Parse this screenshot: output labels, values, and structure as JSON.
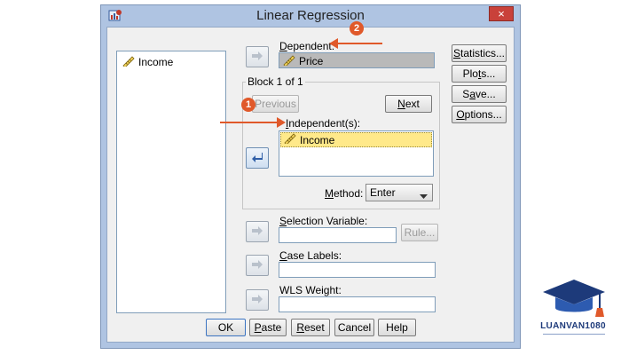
{
  "window": {
    "title": "Linear Regression",
    "close_glyph": "×"
  },
  "source_list": {
    "items": [
      {
        "label": "Income",
        "icon": "ruler-pencil-icon"
      }
    ]
  },
  "dependent": {
    "label_prefix": "D",
    "label_rest": "ependent:",
    "value": "Price"
  },
  "block": {
    "title": "Block 1 of 1",
    "previous_label": "Previous",
    "next_prefix": "N",
    "next_rest": "ext"
  },
  "independent": {
    "label_prefix": "I",
    "label_rest": "ndependent(s):",
    "items": [
      {
        "label": "Income"
      }
    ]
  },
  "method": {
    "label_prefix": "M",
    "label_rest": "ethod:",
    "value": "Enter"
  },
  "selection_variable": {
    "label_prefix": "S",
    "label_rest": "election Variable:",
    "value": "",
    "rule_label": "Rule..."
  },
  "case_labels": {
    "label_prefix": "C",
    "label_rest": "ase Labels:",
    "value": ""
  },
  "wls_weight": {
    "label": "WLS Weight:",
    "value": ""
  },
  "side_buttons": {
    "statistics": {
      "prefix": "S",
      "rest": "tatistics..."
    },
    "plots": {
      "before": "Plo",
      "u": "t",
      "after": "s..."
    },
    "save": {
      "before": "S",
      "u": "a",
      "after": "ve..."
    },
    "options": {
      "prefix": "O",
      "rest": "ptions..."
    }
  },
  "bottom_buttons": {
    "ok": "OK",
    "paste": {
      "prefix": "P",
      "rest": "aste"
    },
    "reset": {
      "prefix": "R",
      "rest": "eset"
    },
    "cancel": "Cancel",
    "help": "Help"
  },
  "annotations": {
    "badge_1": "1",
    "badge_2": "2"
  },
  "logo": {
    "name": "LUANVAN1080"
  },
  "colors": {
    "selected_variable_bg": "#ffe98a",
    "dependent_field_bg": "#b9b9b9",
    "annotation": "#e0592a",
    "window_frame": "#afc4e2"
  }
}
